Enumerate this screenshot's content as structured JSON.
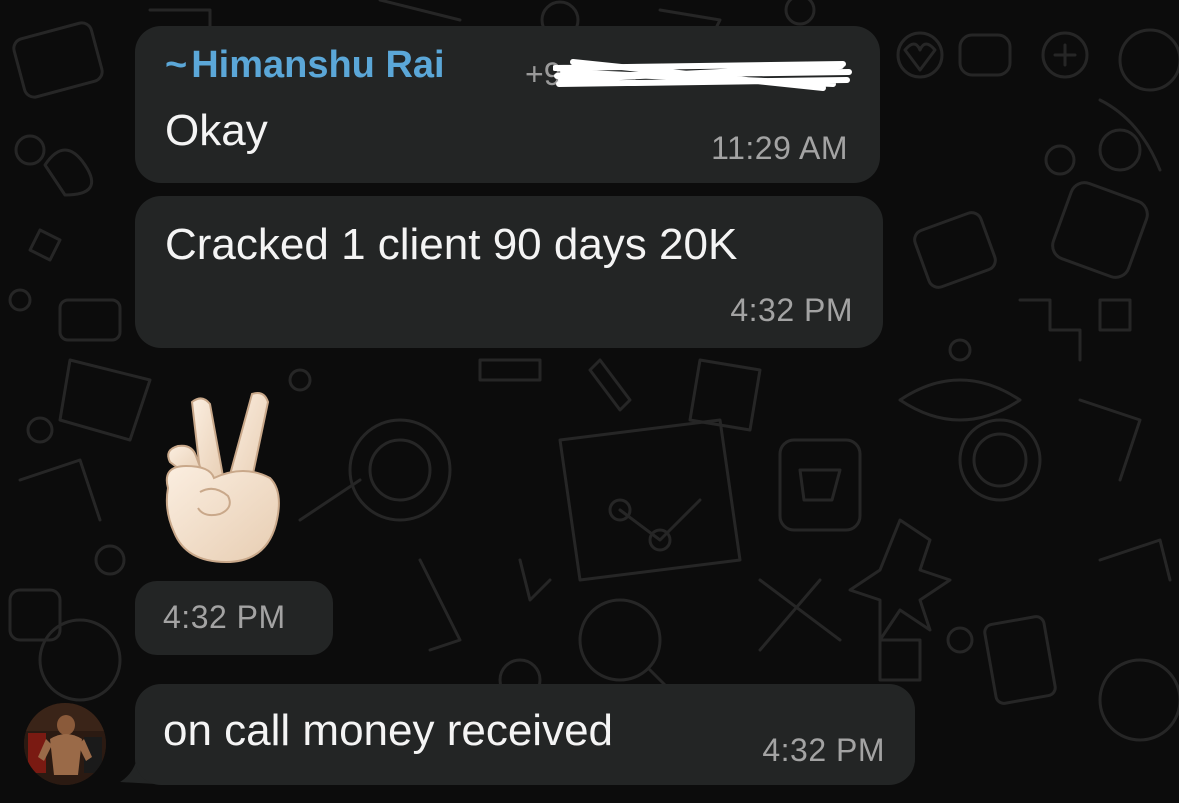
{
  "chat": {
    "messages": [
      {
        "sender_prefix": "~",
        "sender": "Himanshu Rai",
        "phone": "+9",
        "text": "Okay",
        "time": "11:29 AM"
      },
      {
        "text": "Cracked 1 client 90 days 20K",
        "time": "4:32 PM"
      },
      {
        "emoji": "victory-hand-emoji",
        "time": "4:32 PM"
      },
      {
        "text": "on call money received",
        "time": "4:32 PM"
      }
    ]
  },
  "colors": {
    "background": "#0c0c0c",
    "bubble": "#232525",
    "sender_name": "#5ba7d8",
    "timestamp": "#a3a3a3",
    "message_text": "#f4f4f4"
  }
}
